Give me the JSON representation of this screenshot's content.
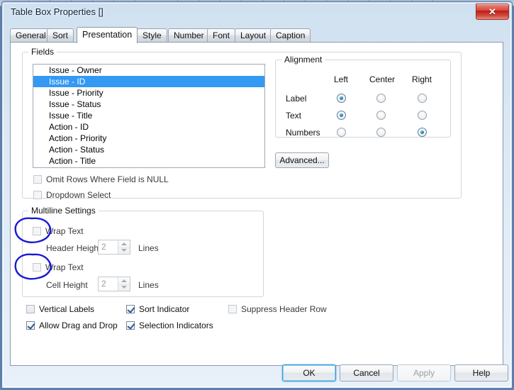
{
  "window": {
    "title": "Table Box Properties []",
    "close_label": "✕",
    "close_icon": "close-icon"
  },
  "tabs": [
    {
      "label": "General",
      "active": false
    },
    {
      "label": "Sort",
      "active": false
    },
    {
      "label": "Presentation",
      "active": true
    },
    {
      "label": "Style",
      "active": false
    },
    {
      "label": "Number",
      "active": false
    },
    {
      "label": "Font",
      "active": false
    },
    {
      "label": "Layout",
      "active": false
    },
    {
      "label": "Caption",
      "active": false
    }
  ],
  "fields_group": {
    "legend": "Fields",
    "items": [
      {
        "label": "Issue - Owner",
        "selected": false
      },
      {
        "label": "Issue - ID",
        "selected": true
      },
      {
        "label": "Issue - Priority",
        "selected": false
      },
      {
        "label": "Issue - Status",
        "selected": false
      },
      {
        "label": "Issue - Title",
        "selected": false
      },
      {
        "label": "Action - ID",
        "selected": false
      },
      {
        "label": "Action - Priority",
        "selected": false
      },
      {
        "label": "Action - Status",
        "selected": false
      },
      {
        "label": "Action - Title",
        "selected": false
      }
    ],
    "omit_rows_label": "Omit Rows Where Field is NULL",
    "omit_rows_checked": false,
    "dropdown_select_label": "Dropdown Select",
    "dropdown_select_checked": false
  },
  "alignment": {
    "legend": "Alignment",
    "columns": [
      "Left",
      "Center",
      "Right"
    ],
    "rows": [
      {
        "label": "Label",
        "selected": "Left"
      },
      {
        "label": "Text",
        "selected": "Left"
      },
      {
        "label": "Numbers",
        "selected": "Right"
      }
    ],
    "advanced_label": "Advanced..."
  },
  "multiline": {
    "legend": "Multiline Settings",
    "header_wrap_label": "Wrap Text",
    "header_wrap_checked": false,
    "header_height_label": "Header Height",
    "header_height_value": "2",
    "header_height_units": "Lines",
    "cell_wrap_label": "Wrap Text",
    "cell_wrap_checked": false,
    "cell_height_label": "Cell Height",
    "cell_height_value": "2",
    "cell_height_units": "Lines"
  },
  "options": [
    {
      "label": "Vertical Labels",
      "checked": false,
      "dim": false
    },
    {
      "label": "Sort Indicator",
      "checked": true,
      "dim": false
    },
    {
      "label": "Suppress Header Row",
      "checked": false,
      "dim": true
    },
    {
      "label": "Allow Drag and Drop",
      "checked": true,
      "dim": false
    },
    {
      "label": "Selection Indicators",
      "checked": true,
      "dim": false
    }
  ],
  "footer": {
    "ok_label": "OK",
    "cancel_label": "Cancel",
    "apply_label": "Apply",
    "help_label": "Help"
  },
  "annotation": {
    "color": "#1a1ad4",
    "shapes": "two hand-drawn ellipses circling the Wrap Text checkboxes"
  }
}
